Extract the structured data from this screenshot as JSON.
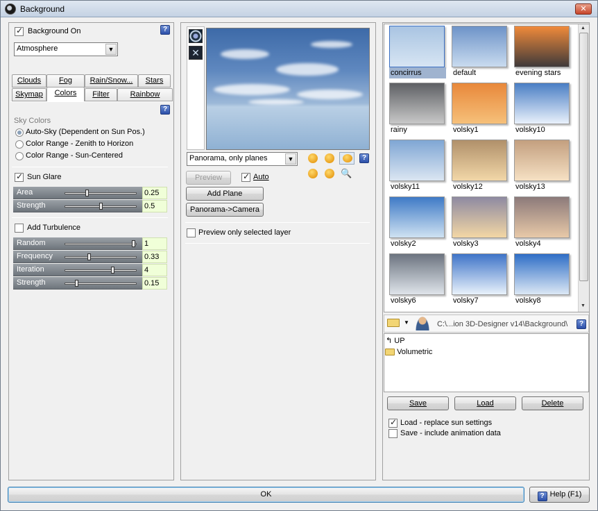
{
  "window": {
    "title": "Background",
    "close_glyph": "✕"
  },
  "left": {
    "background_on": {
      "label": "Background On",
      "checked": true
    },
    "mode_select": {
      "value": "Atmosphere"
    },
    "tabs_row1": [
      "Clouds",
      "Fog",
      "Rain/Snow...",
      "Stars"
    ],
    "tabs_row2": [
      "Skymap",
      "Colors",
      "Filter",
      "Rainbow"
    ],
    "active_tab": "Colors",
    "sky_colors": {
      "heading": "Sky Colors",
      "options": [
        "Auto-Sky (Dependent on Sun Pos.)",
        "Color Range - Zenith to Horizon",
        "Color Range - Sun-Centered"
      ],
      "selected_index": 0
    },
    "sun_glare": {
      "label": "Sun Glare",
      "checked": true
    },
    "glare_sliders": [
      {
        "name": "Area",
        "value": "0.25",
        "fraction": 0.3
      },
      {
        "name": "Strength",
        "value": "0.5",
        "fraction": 0.5
      }
    ],
    "turbulence": {
      "label": "Add Turbulence",
      "checked": false
    },
    "turb_sliders": [
      {
        "name": "Random",
        "value": "1",
        "fraction": 0.97
      },
      {
        "name": "Frequency",
        "value": "0.33",
        "fraction": 0.33
      },
      {
        "name": "Iteration",
        "value": "4",
        "fraction": 0.67
      },
      {
        "name": "Strength",
        "value": "0.15",
        "fraction": 0.15
      }
    ],
    "help_glyph": "?"
  },
  "center": {
    "panorama_select": {
      "value": "Panorama, only planes"
    },
    "preview_button": "Preview",
    "auto": {
      "label": "Auto",
      "checked": true
    },
    "add_plane_button": "Add Plane",
    "panorama_camera_button": "Panorama->Camera",
    "preview_selected_layer": {
      "label": "Preview only selected layer",
      "checked": false
    }
  },
  "right": {
    "presets": [
      {
        "name": "concirrus",
        "selected": true,
        "colors": [
          "#a9c4e2",
          "#d7e5f3"
        ]
      },
      {
        "name": "default",
        "selected": false,
        "colors": [
          "#6d93c8",
          "#c9dbef"
        ]
      },
      {
        "name": "evening stars",
        "selected": false,
        "colors": [
          "#f08a3a",
          "#3f3a3a"
        ]
      },
      {
        "name": "rainy",
        "selected": false,
        "colors": [
          "#5e6064",
          "#c8c8c8"
        ]
      },
      {
        "name": "volsky1",
        "selected": false,
        "colors": [
          "#e8883a",
          "#f6c07a"
        ]
      },
      {
        "name": "volsky10",
        "selected": false,
        "colors": [
          "#4a7ec4",
          "#e9f1fb"
        ]
      },
      {
        "name": "volsky11",
        "selected": false,
        "colors": [
          "#7fa6d4",
          "#dbe6f2"
        ]
      },
      {
        "name": "volsky12",
        "selected": false,
        "colors": [
          "#b0906a",
          "#f2d7a8"
        ]
      },
      {
        "name": "volsky13",
        "selected": false,
        "colors": [
          "#c39f7f",
          "#f6e1c4"
        ]
      },
      {
        "name": "volsky2",
        "selected": false,
        "colors": [
          "#3f7ac6",
          "#cfe2f2"
        ]
      },
      {
        "name": "volsky3",
        "selected": false,
        "colors": [
          "#8e8aa2",
          "#f3d7a4"
        ]
      },
      {
        "name": "volsky4",
        "selected": false,
        "colors": [
          "#8c7a7a",
          "#e8c9a8"
        ]
      },
      {
        "name": "volsky6",
        "selected": false,
        "colors": [
          "#6c7480",
          "#dfe4ea"
        ]
      },
      {
        "name": "volsky7",
        "selected": false,
        "colors": [
          "#3f74c8",
          "#e9f2fb"
        ]
      },
      {
        "name": "volsky8",
        "selected": false,
        "colors": [
          "#2f6ec6",
          "#dce8f5"
        ]
      }
    ],
    "path": "C:\\...ion 3D-Designer v14\\Background\\",
    "file_list": [
      "UP",
      "Volumetric"
    ],
    "save_button": "Save",
    "load_button": "Load",
    "delete_button": "Delete",
    "load_replace": {
      "label": "Load - replace sun settings",
      "checked": true
    },
    "save_include": {
      "label": "Save - include animation data",
      "checked": false
    }
  },
  "footer": {
    "ok_button": "OK",
    "help_button": "Help (F1)"
  }
}
